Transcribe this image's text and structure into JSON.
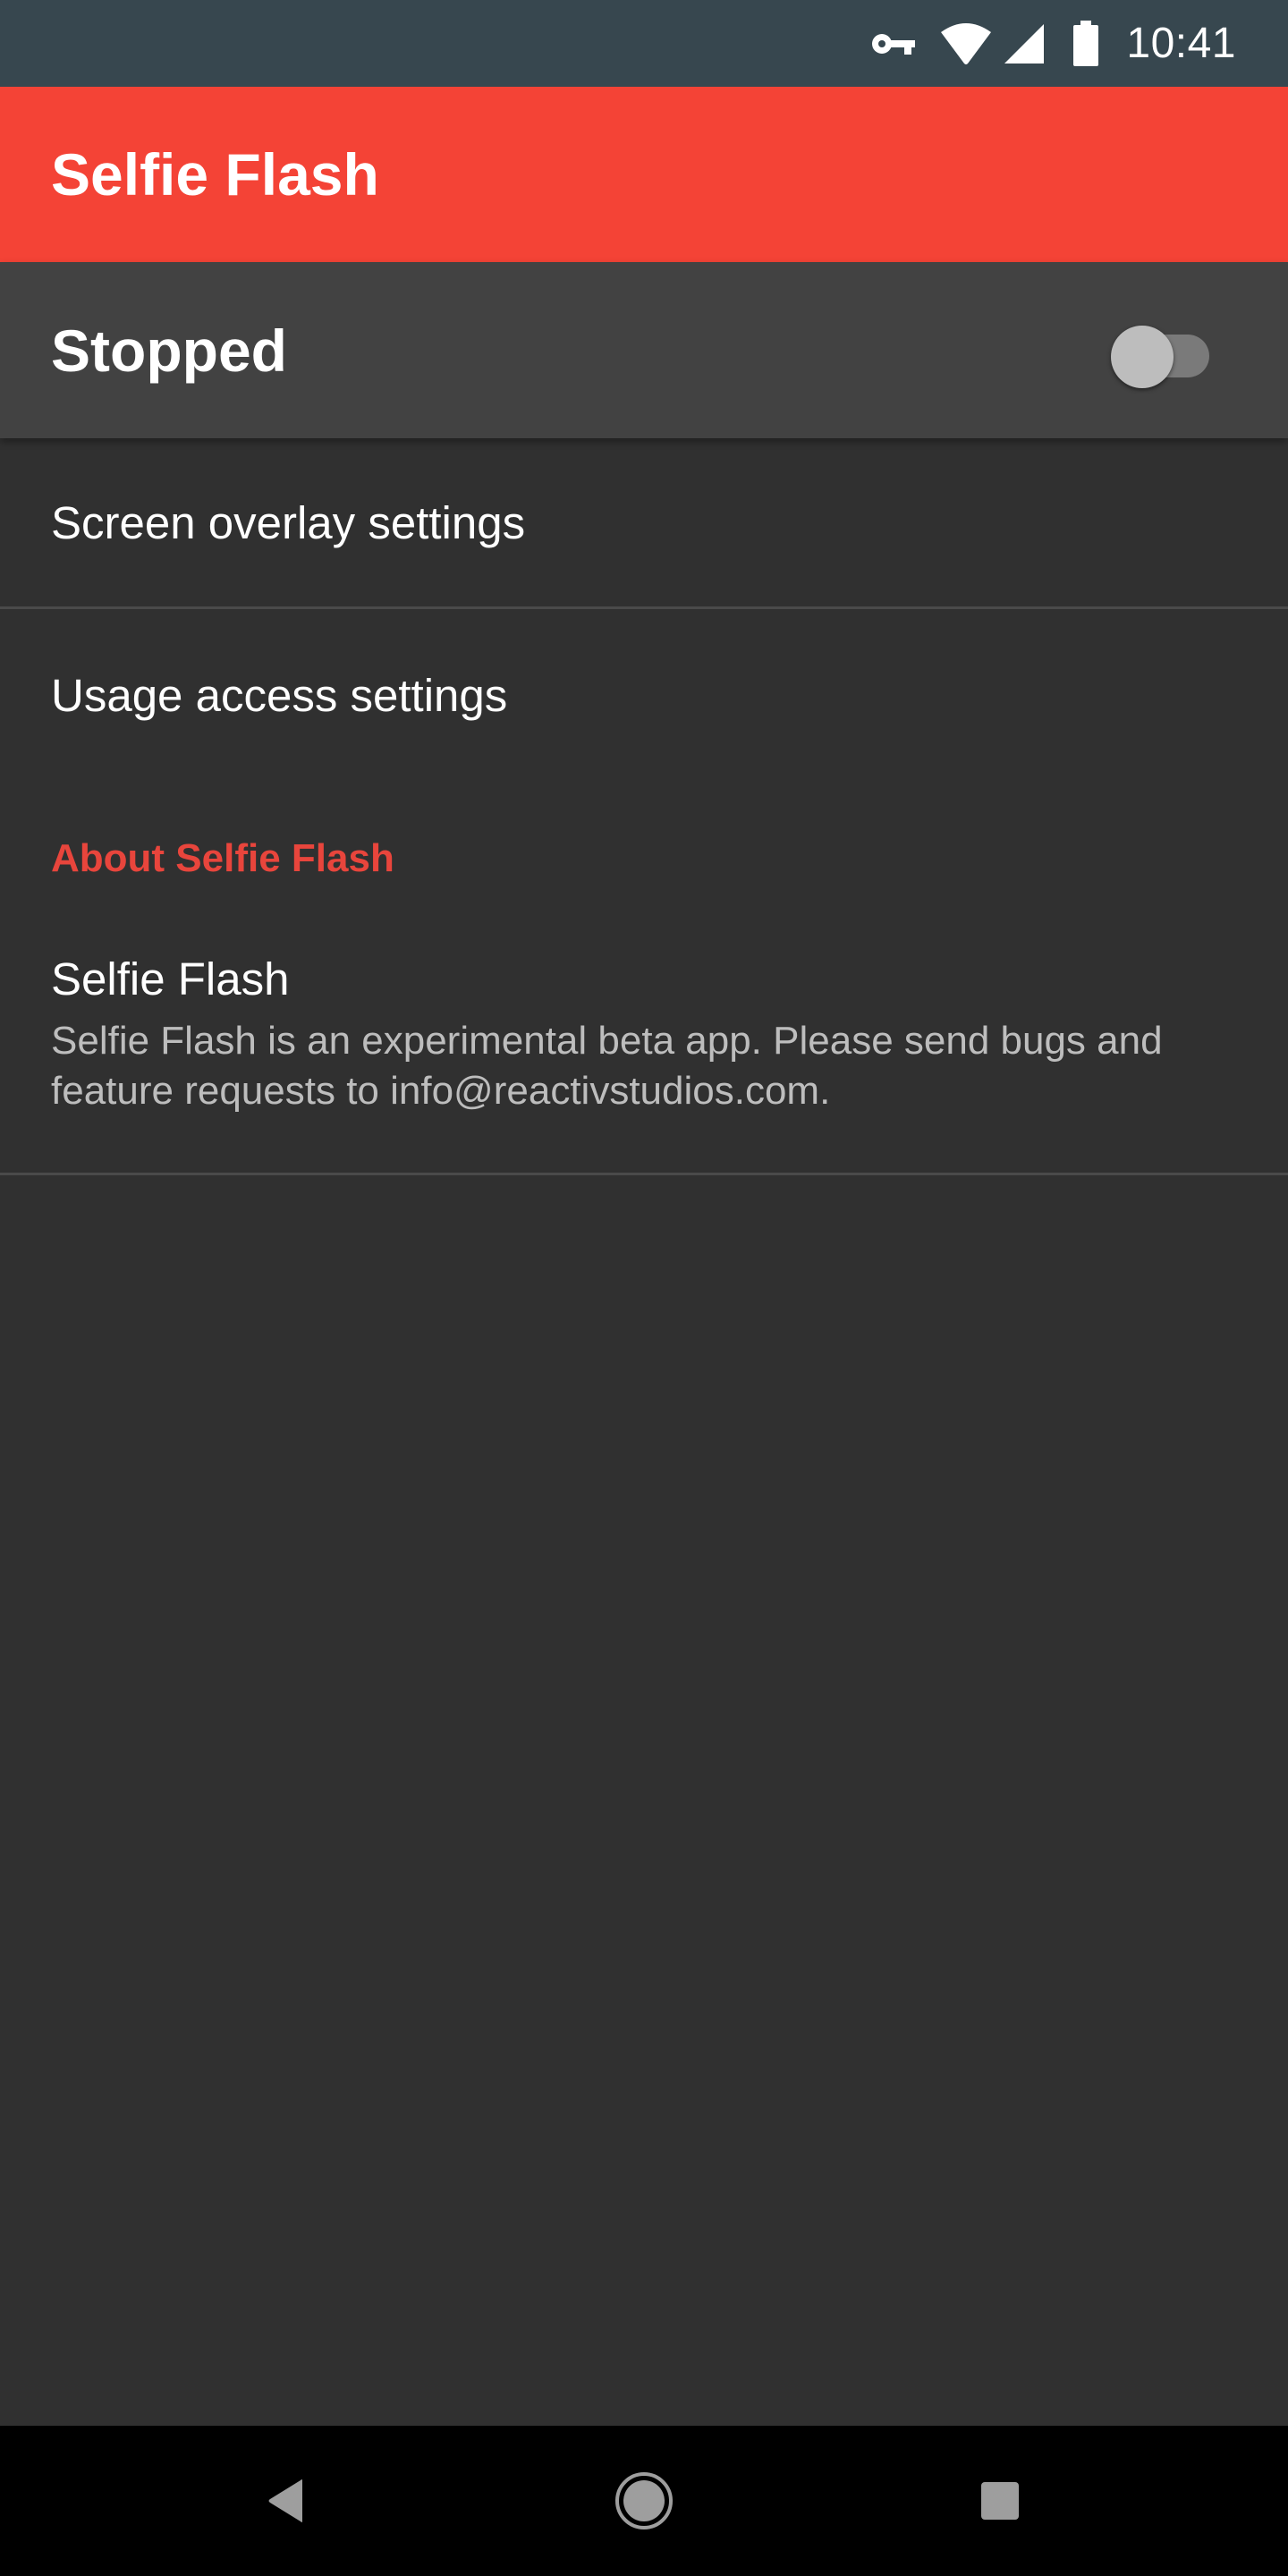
{
  "status_bar": {
    "icons": [
      "vpn-key-icon",
      "wifi-icon",
      "cellular-signal-icon",
      "battery-icon"
    ],
    "time": "10:41"
  },
  "toolbar": {
    "title": "Selfie Flash",
    "color": "#f44336"
  },
  "master_switch": {
    "label": "Stopped",
    "checked": false
  },
  "preferences": [
    {
      "title": "Screen overlay settings"
    },
    {
      "title": "Usage access settings"
    }
  ],
  "about": {
    "category_title": "About Selfie Flash",
    "category_color": "#e8453c",
    "item_title": "Selfie Flash",
    "item_summary": "Selfie Flash is an experimental beta app. Please send bugs and feature requests to info@reactivstudios.com."
  },
  "nav_bar": {
    "buttons": [
      "back-icon",
      "home-icon",
      "recents-icon"
    ]
  }
}
